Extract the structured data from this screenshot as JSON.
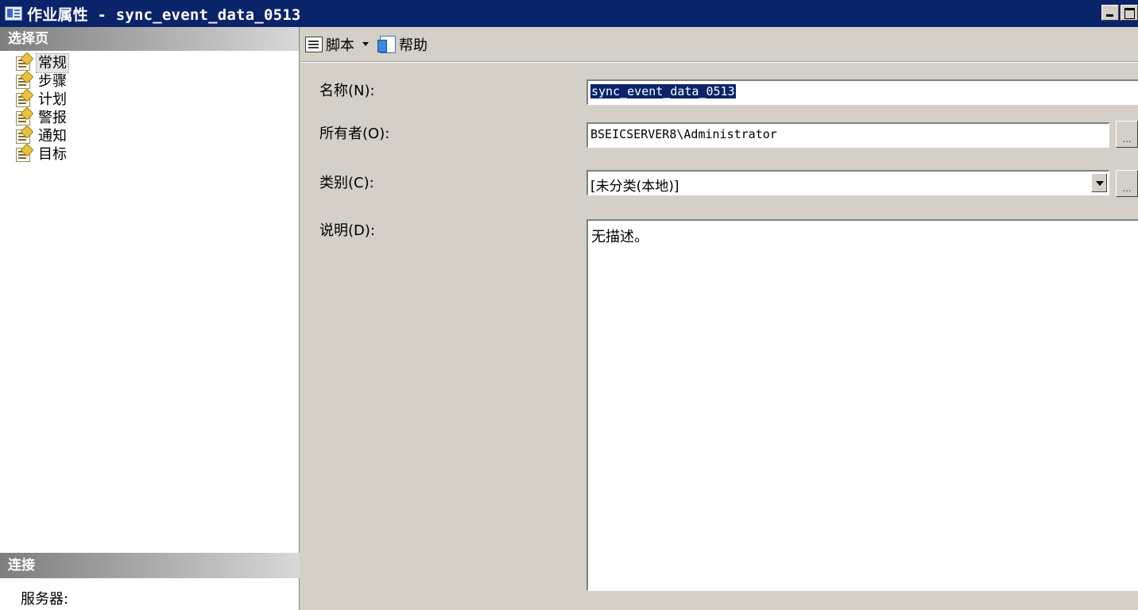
{
  "window": {
    "title": "作业属性 - sync_event_data_0513",
    "icon": "window-app-icon"
  },
  "left_pane": {
    "header": "选择页",
    "pages": [
      {
        "label": "常规",
        "selected": true
      },
      {
        "label": "步骤",
        "selected": false
      },
      {
        "label": "计划",
        "selected": false
      },
      {
        "label": "警报",
        "selected": false
      },
      {
        "label": "通知",
        "selected": false
      },
      {
        "label": "目标",
        "selected": false
      }
    ],
    "connection_header": "连接",
    "server_label": "服务器:"
  },
  "toolbar": {
    "script_label": "脚本",
    "help_label": "帮助"
  },
  "form": {
    "name_label": "名称(N):",
    "name_value": "sync_event_data_0513",
    "owner_label": "所有者(O):",
    "owner_value": "BSEICSERVER8\\Administrator",
    "owner_browse": "...",
    "category_label": "类别(C):",
    "category_value": "[未分类(本地)]",
    "category_browse": "...",
    "description_label": "说明(D):",
    "description_value": "无描述。"
  },
  "colors": {
    "titlebar": "#0a246a",
    "dialog_bg": "#d4d0c8",
    "selection": "#0a246a"
  }
}
